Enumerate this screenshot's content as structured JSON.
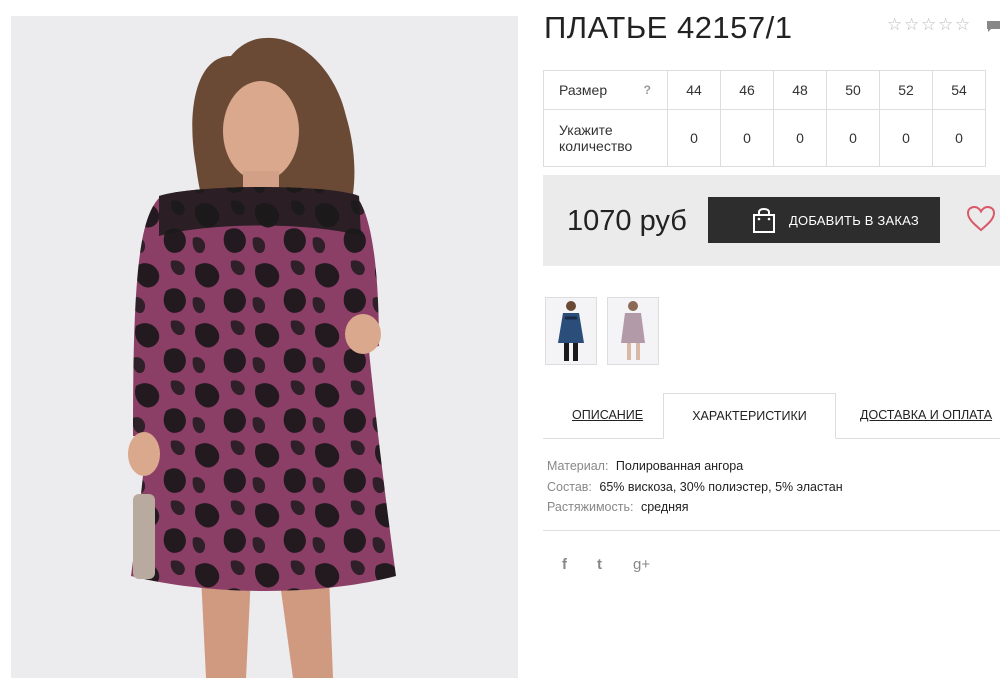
{
  "product": {
    "title": "ПЛАТЬЕ 42157/1",
    "rating_stars": 5,
    "price": "1070 руб",
    "order_button": "ДОБАВИТЬ В ЗАКАЗ"
  },
  "sizes": {
    "size_label": "Размер",
    "help": "?",
    "qty_label": "Укажите количество",
    "items": [
      {
        "size": "44",
        "qty": "0"
      },
      {
        "size": "46",
        "qty": "0"
      },
      {
        "size": "48",
        "qty": "0"
      },
      {
        "size": "50",
        "qty": "0"
      },
      {
        "size": "52",
        "qty": "0"
      },
      {
        "size": "54",
        "qty": "0"
      }
    ]
  },
  "tabs": [
    {
      "label": "ОПИСАНИЕ",
      "active": false
    },
    {
      "label": "ХАРАКТЕРИСТИКИ",
      "active": true
    },
    {
      "label": "ДОСТАВКА И ОПЛАТА",
      "active": false
    }
  ],
  "specs": [
    {
      "key": "Материал:",
      "value": "Полированная ангора"
    },
    {
      "key": "Состав:",
      "value": "65% вискоза, 30% полиэстер, 5% эластан"
    },
    {
      "key": "Растяжимость:",
      "value": "средняя"
    }
  ],
  "social": {
    "facebook": "f",
    "twitter": "t",
    "googleplus": "g+"
  },
  "icons": {
    "star": "star-outline-icon",
    "comment": "comment-icon",
    "bag": "shopping-bag-icon",
    "heart": "heart-icon"
  },
  "colors": {
    "button_bg": "#2d2d2d",
    "price_bar_bg": "#ebebeb",
    "heart": "#d9586a",
    "dress_main": "#8c3f66",
    "dress_dark": "#231a20"
  }
}
